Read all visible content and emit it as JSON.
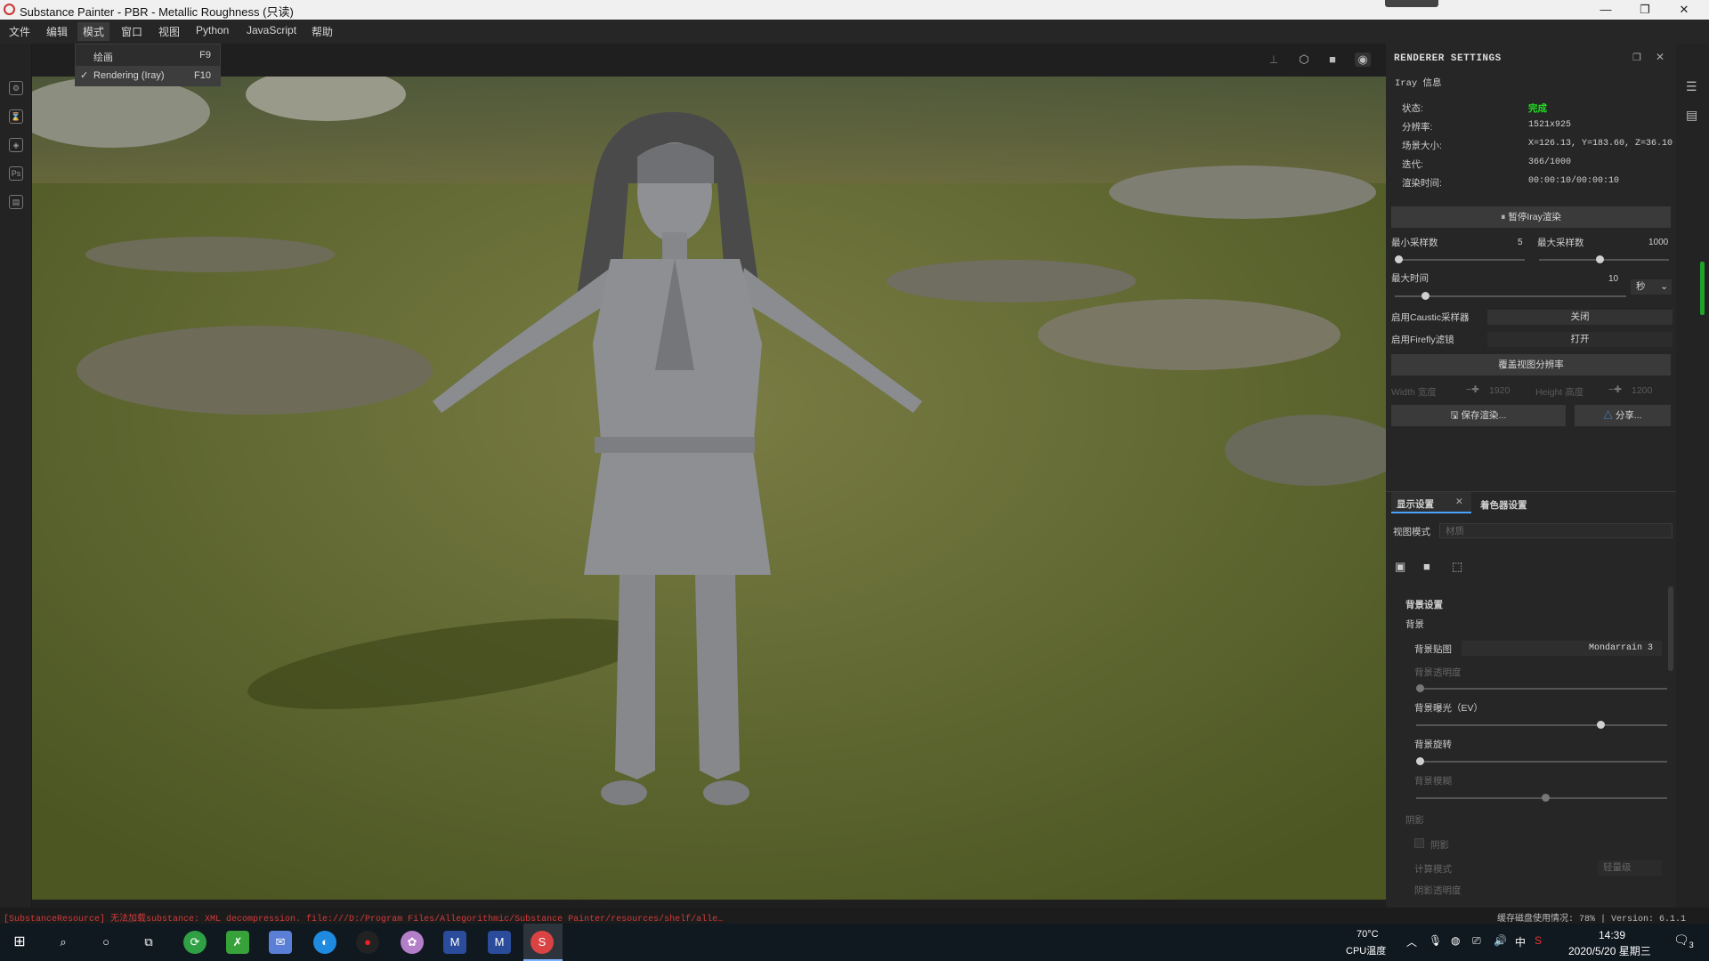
{
  "window": {
    "title": "Substance Painter - PBR - Metallic Roughness (只读)",
    "min": "—",
    "max": "❐",
    "close": "✕"
  },
  "menubar": [
    "文件",
    "编辑",
    "模式",
    "窗口",
    "视图",
    "Python",
    "JavaScript",
    "帮助"
  ],
  "mode_menu": [
    {
      "label": "绘画",
      "shortcut": "F9",
      "checked": false
    },
    {
      "label": "Rendering (Iray)",
      "shortcut": "F10",
      "checked": true
    }
  ],
  "left_tools": [
    "gear-icon",
    "hourglass-icon",
    "layer-icon",
    "ps-icon",
    "export-icon"
  ],
  "left_tool_glyphs": [
    "⚙",
    "⌛",
    "◈",
    "Ps",
    "▤"
  ],
  "renderer": {
    "title": "RENDERER SETTINGS",
    "section": "Iray 信息",
    "info": [
      {
        "label": "状态:",
        "value": "完成"
      },
      {
        "label": "分辨率:",
        "value": "1521x925"
      },
      {
        "label": "场景大小:",
        "value": "X=126.13, Y=183.60, Z=36.10"
      },
      {
        "label": "迭代:",
        "value": "366/1000"
      },
      {
        "label": "渲染时间:",
        "value": "00:00:10/00:00:10"
      }
    ],
    "pause_button": "暂停Iray渲染",
    "min_samples_label": "最小采样数",
    "min_samples": "5",
    "max_samples_label": "最大采样数",
    "max_samples": "1000",
    "max_time_label": "最大时间",
    "max_time": "10",
    "time_unit": "秒",
    "caustic_label": "启用Caustic采样器",
    "caustic_value": "关闭",
    "firefly_label": "启用Firefly滤镜",
    "firefly_value": "打开",
    "override_button": "覆盖视图分辨率",
    "width_label": "Width 宽度",
    "width_value": "1920",
    "height_label": "Height 高度",
    "height_value": "1200",
    "save_button": "保存渲染...",
    "share_button": "分享..."
  },
  "display": {
    "tab1": "显示设置",
    "tab2": "着色器设置",
    "viewmode_label": "视图模式",
    "viewmode_value": "材质",
    "bg_settings": "背景设置",
    "bg": "背景",
    "bg_map_label": "背景贴图",
    "bg_map_value": "Mondarrain 3",
    "bg_opacity_label": "背景透明度",
    "bg_opacity": 0.0,
    "bg_exposure_label": "背景曝光（EV）",
    "bg_exposure": 0.72,
    "bg_rotation_label": "背景旋转",
    "bg_rotation": 0.0,
    "bg_blur_label": "背景模糊",
    "bg_blur": 0.5,
    "shadow_label": "阴影",
    "shadow_check": "阴影",
    "calc_mode_label": "计算模式",
    "calc_mode_value": "轻量级",
    "shadow_opacity_label": "阴影透明度"
  },
  "status": {
    "error": "[SubstanceResource] 无法加载substance: XML decompression. file:///D:/Program Files/Allegorithmic/Substance Painter/resources/shelf/alle…",
    "cache": "缓存磁盘使用情况: 78% | Version: 6.1.1"
  },
  "taskbar": {
    "temp": "70°C",
    "temp_label": "CPU温度",
    "time": "14:39",
    "date": "2020/5/20 星期三",
    "notif": "3"
  },
  "colors": {
    "accent_green": "#22dd22",
    "panel_bg": "#262626",
    "error_red": "#d43a3a"
  }
}
